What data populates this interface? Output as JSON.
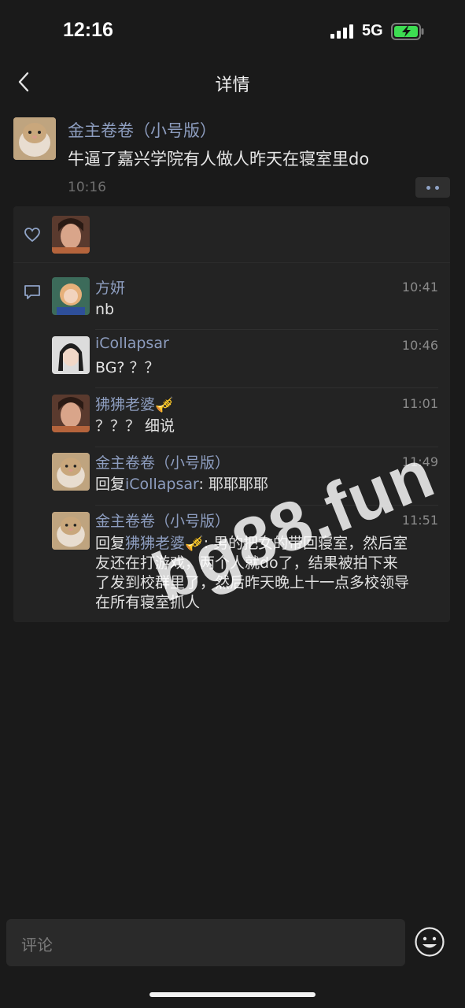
{
  "status": {
    "time": "12:16",
    "network": "5G"
  },
  "nav": {
    "title": "详情"
  },
  "post": {
    "author": "金主卷卷（小号版）",
    "text": "牛逼了嘉兴学院有人做人昨天在寝室里do",
    "time": "10:16"
  },
  "comments": [
    {
      "name": "方妍",
      "time": "10:41",
      "text": "nb"
    },
    {
      "name": "iCollapsar",
      "time": "10:46",
      "text": "BG? ？？"
    },
    {
      "name": "狒狒老婆🎺",
      "time": "11:01",
      "text": "？？？ 细说"
    },
    {
      "name": "金主卷卷（小号版）",
      "time": "11:49",
      "reply_prefix": "回复",
      "reply_to": "iCollapsar",
      "text": ": 耶耶耶耶"
    },
    {
      "name": "金主卷卷（小号版）",
      "time": "11:51",
      "reply_prefix": "回复",
      "reply_to": "狒狒老婆🎺",
      "text_lines": [
        ": 男的把女的带回寝室，然后室",
        "友还在打游戏，两个人就do了，结果被拍下来",
        "了发到校群里了，然后昨天晚上十一点多校领导",
        "在所有寝室抓人"
      ]
    }
  ],
  "input": {
    "placeholder": "评论"
  },
  "watermark": "bg88.fun",
  "colors": {
    "name_blue": "#8d9dbf",
    "background": "#1a1a1a",
    "panel": "#232323"
  }
}
